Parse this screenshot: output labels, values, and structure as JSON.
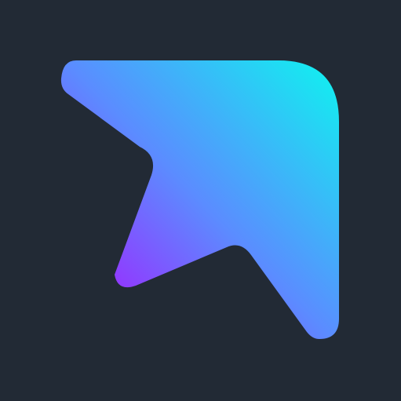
{
  "app_icon": {
    "name": "arrow-logo",
    "background_color": "#222a35",
    "gradient": {
      "start": "#8f3cff",
      "mid": "#5b8cff",
      "end": "#11f0f0"
    }
  }
}
